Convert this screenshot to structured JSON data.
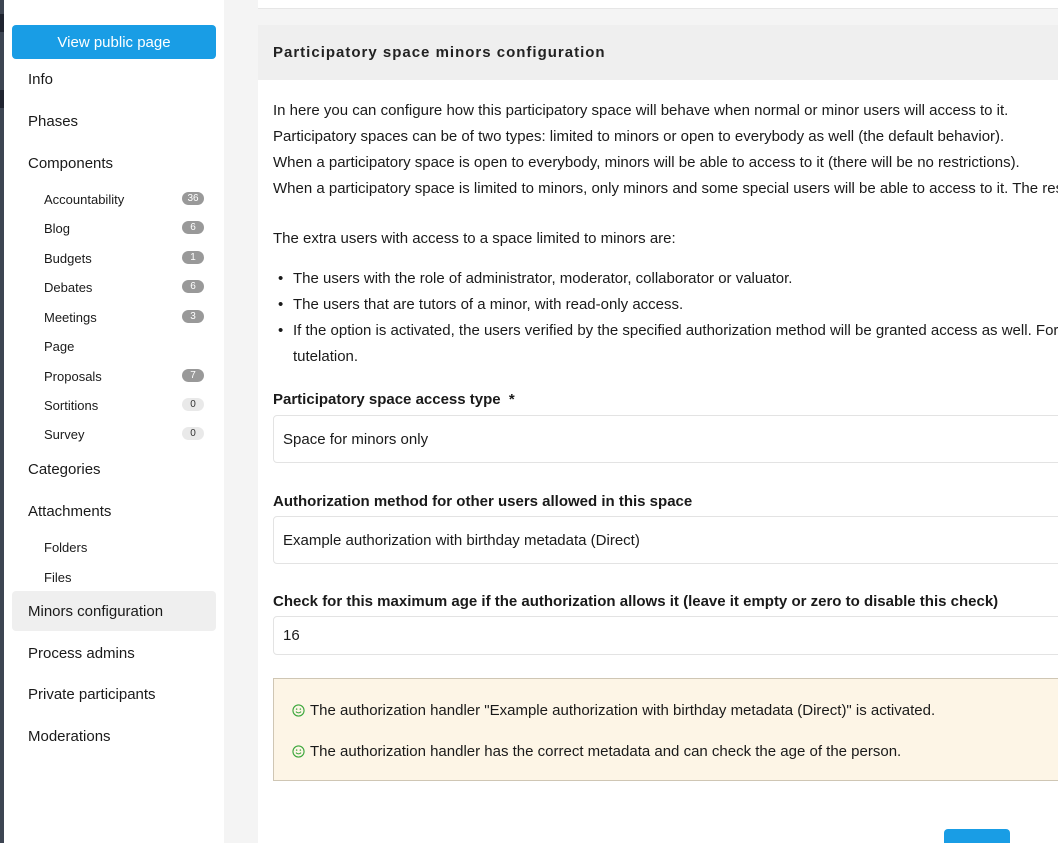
{
  "sidebar": {
    "public_button": "View public page",
    "items": [
      {
        "label": "Info"
      },
      {
        "label": "Phases"
      },
      {
        "label": "Components"
      },
      {
        "label": "Categories"
      },
      {
        "label": "Attachments"
      },
      {
        "label": "Minors configuration",
        "active": true
      },
      {
        "label": "Process admins"
      },
      {
        "label": "Private participants"
      },
      {
        "label": "Moderations"
      }
    ],
    "components": [
      {
        "label": "Accountability",
        "count": "36"
      },
      {
        "label": "Blog",
        "count": "6"
      },
      {
        "label": "Budgets",
        "count": "1"
      },
      {
        "label": "Debates",
        "count": "6"
      },
      {
        "label": "Meetings",
        "count": "3"
      },
      {
        "label": "Page",
        "count": ""
      },
      {
        "label": "Proposals",
        "count": "7"
      },
      {
        "label": "Sortitions",
        "count": "0"
      },
      {
        "label": "Survey",
        "count": "0"
      }
    ],
    "attachments": [
      {
        "label": "Folders"
      },
      {
        "label": "Files"
      }
    ]
  },
  "main": {
    "title": "Participatory space minors configuration",
    "intro": [
      "In here you can configure how this participatory space will behave when normal or minor users will access to it.",
      "Participatory spaces can be of two types: limited to minors or open to everybody as well (the default behavior).",
      "When a participatory space is open to everybody, minors will be able to access to it (there will be no restrictions).",
      "When a participatory space is limited to minors, only minors and some special users will be able to access to it. The res"
    ],
    "extra_intro": "The extra users with access to a space limited to minors are:",
    "bullets": [
      "The users with the role of administrator, moderator, collaborator or valuator.",
      "The users that are tutors of a minor, with read-only access.",
      "If the option is activated, the users verified by the specified authorization method will be granted access as well. For",
      "tutelation."
    ],
    "access_type": {
      "label": "Participatory space access type",
      "required_mark": "*",
      "value": "Space for minors only"
    },
    "auth_method": {
      "label": "Authorization method for other users allowed in this space",
      "value": "Example authorization with birthday metadata (Direct)"
    },
    "max_age": {
      "label": "Check for this maximum age if the authorization allows it (leave it empty or zero to disable this check)",
      "value": "16"
    },
    "callout": [
      "The authorization handler \"Example authorization with birthday metadata (Direct)\" is activated.",
      "The authorization handler has the correct metadata and can check the age of the person."
    ]
  },
  "colors": {
    "primary": "#199de5",
    "callout_bg": "#fdf5e6",
    "smile": "#3aa63a"
  }
}
